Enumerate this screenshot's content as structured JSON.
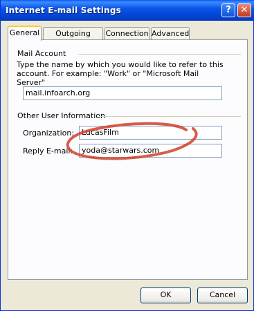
{
  "window": {
    "title": "Internet E-mail Settings",
    "help_glyph": "?",
    "close_glyph": "✕"
  },
  "tabs": [
    {
      "label": "General"
    },
    {
      "label": "Outgoing Server"
    },
    {
      "label": "Connection"
    },
    {
      "label": "Advanced"
    }
  ],
  "mail_account": {
    "group_label": "Mail Account",
    "description": "Type the name by which you would like to refer to this account.  For example: \"Work\" or \"Microsoft Mail Server\"",
    "value": "mail.infoarch.org"
  },
  "other_info": {
    "group_label": "Other User Information",
    "organization_label": "Organization:",
    "organization_value": "LucasFilm",
    "reply_label": "Reply E-mail:",
    "reply_value": "yoda@starwars.com"
  },
  "buttons": {
    "ok": "OK",
    "cancel": "Cancel"
  },
  "colors": {
    "annotation_stroke": "#D0402A",
    "titlebar": "#0A55E8"
  }
}
